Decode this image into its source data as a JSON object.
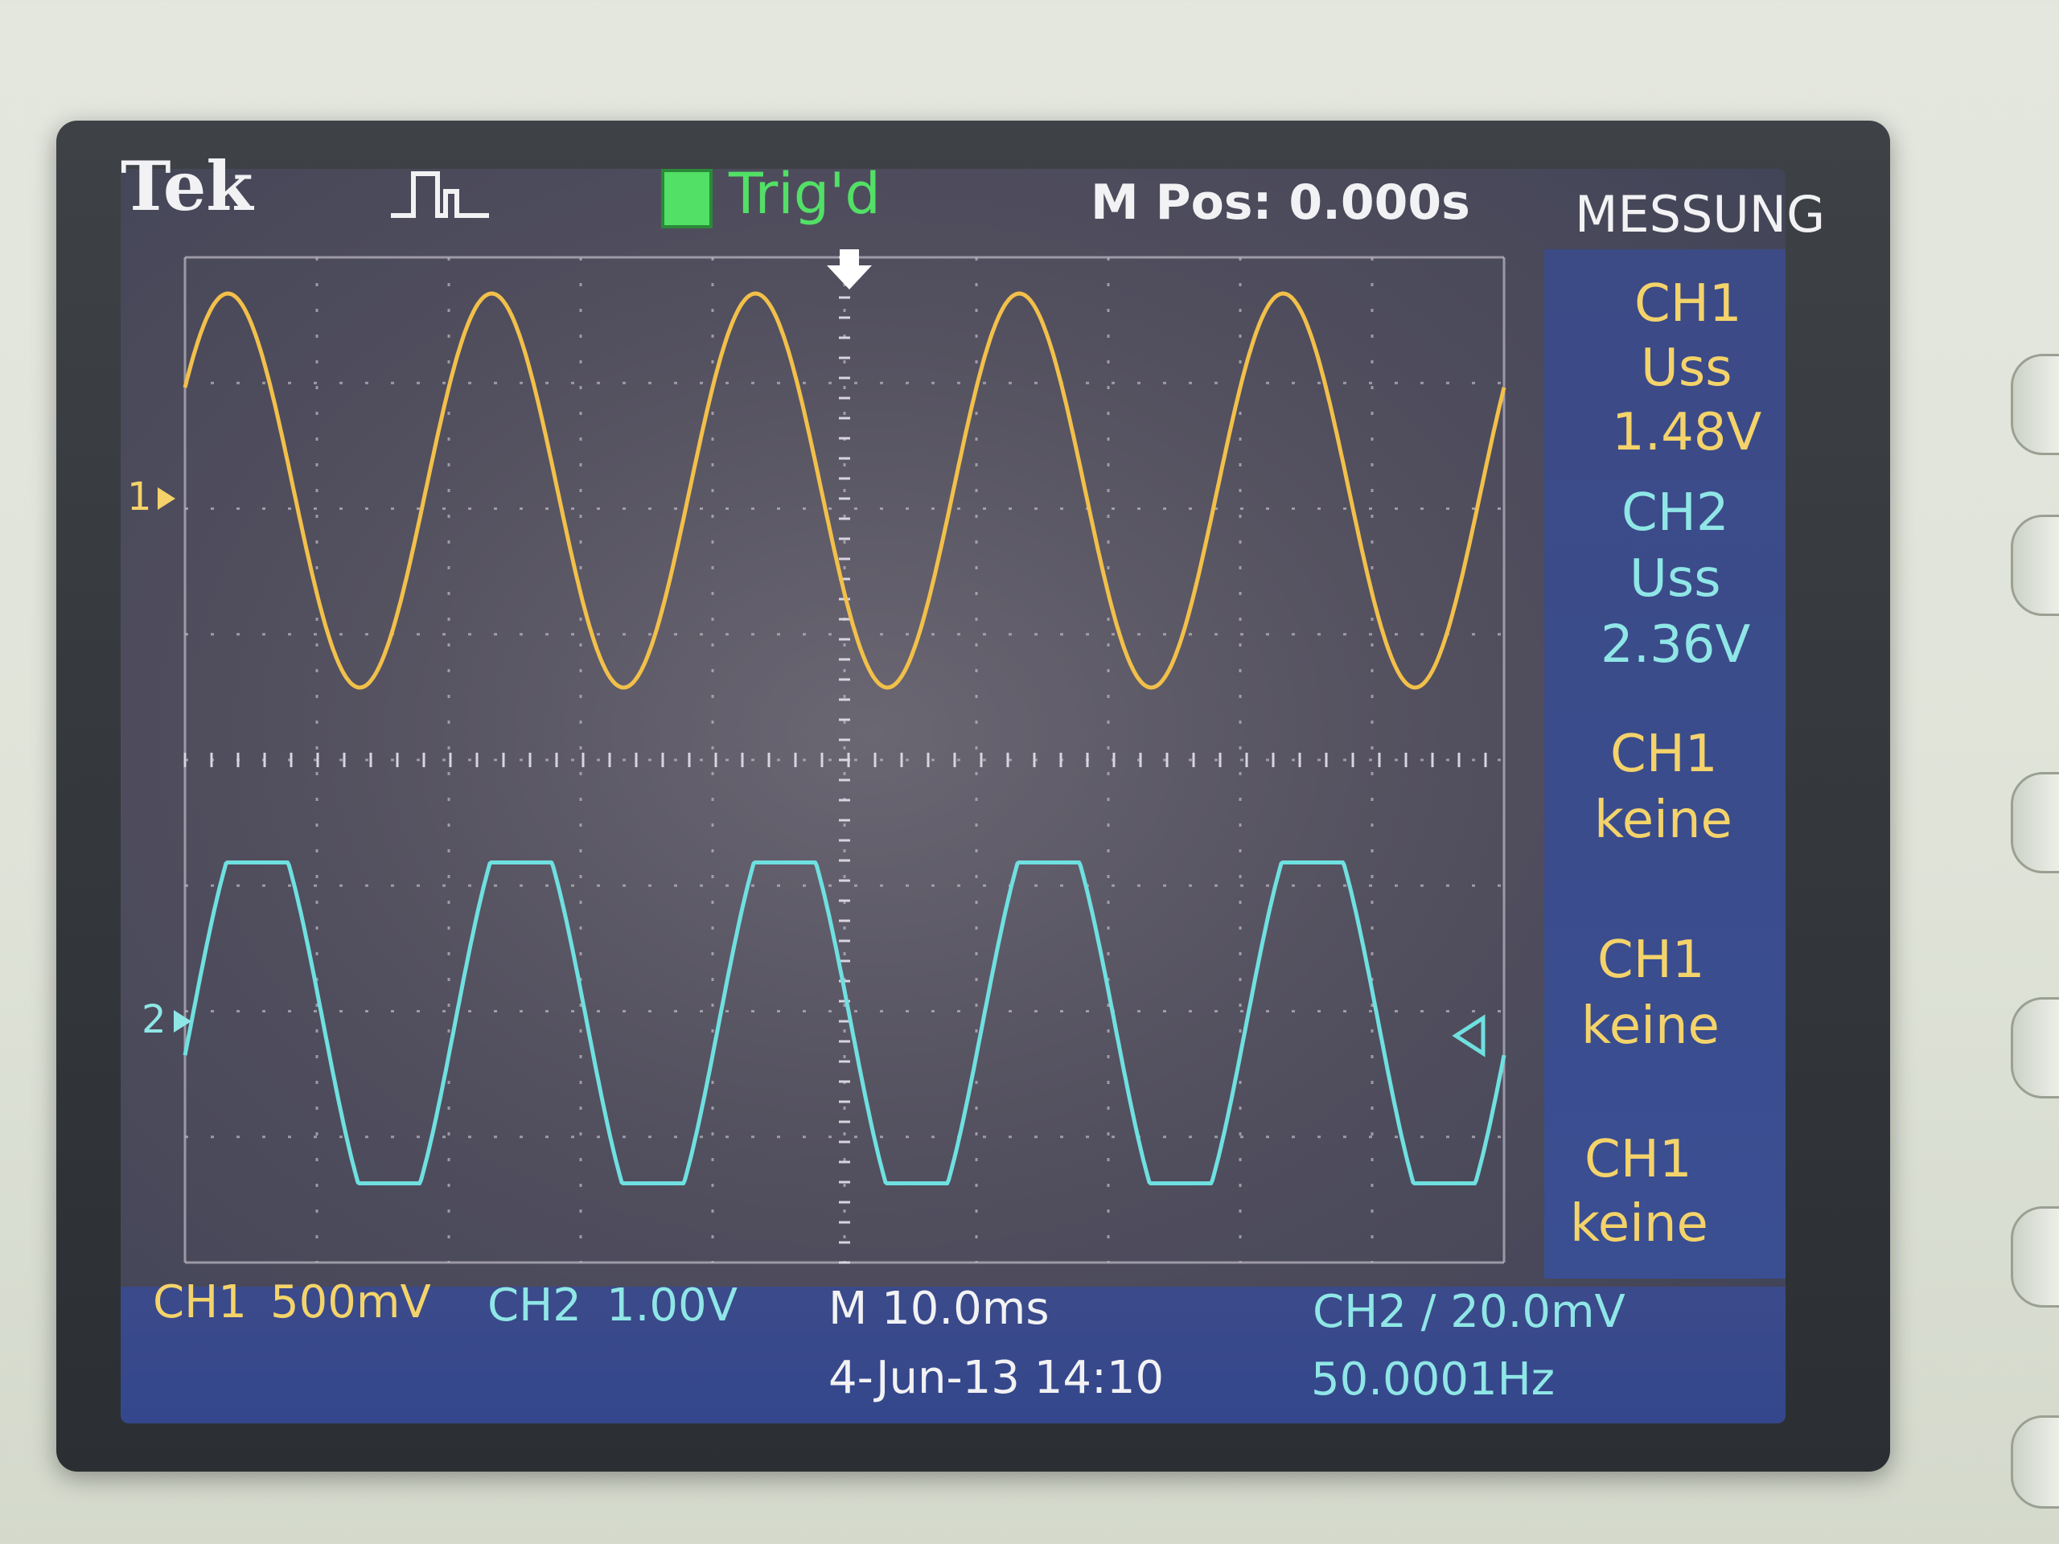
{
  "header": {
    "brand": "Tek",
    "trigger_status": "Trig'd",
    "position": "M Pos: 0.000s",
    "menu_title": "MESSUNG"
  },
  "measurements": [
    {
      "channel": "CH1",
      "type": "Uss",
      "value": "1.48V",
      "color": "#f4d36a"
    },
    {
      "channel": "CH2",
      "type": "Uss",
      "value": "2.36V",
      "color": "#8fe6e6"
    },
    {
      "channel": "CH1",
      "type": "keine",
      "color": "#f4d36a"
    },
    {
      "channel": "CH1",
      "type": "keine",
      "color": "#f4d36a"
    },
    {
      "channel": "CH1",
      "type": "keine",
      "color": "#f4d36a"
    }
  ],
  "footer": {
    "ch1_label": "CH1",
    "ch1_scale": "500mV",
    "ch2_label": "CH2",
    "ch2_scale": "1.00V",
    "timebase": "M 10.0ms",
    "date_time": "4-Jun-13 14:10",
    "trigger_setting": "CH2 ∕ 20.0mV",
    "frequency": "50.0001Hz"
  },
  "markers": {
    "ch1": "1",
    "ch2": "2"
  },
  "signals": {
    "ch1": {
      "name": "CH1",
      "color": "#f2c04a",
      "cycles": 5,
      "shape": "sine"
    },
    "ch2": {
      "name": "CH2",
      "color": "#6fe0e0",
      "cycles": 5,
      "shape": "clipped-sine"
    }
  },
  "colors": {
    "ch1": "#f4d36a",
    "ch2": "#8fe6e6",
    "trigger_ok": "#52e066",
    "text": "#f2f2f4",
    "panel": "#3a4e92"
  }
}
